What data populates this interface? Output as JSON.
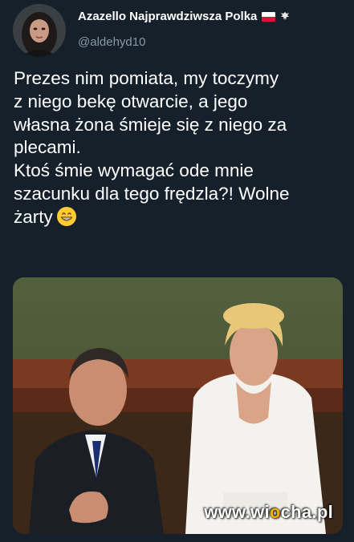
{
  "tweet": {
    "display_name": "Azazello Najprawdziwsza Polka",
    "handle": "@aldehyd10",
    "text": "Prezes nim pomiata, my toczymy\nz niego bekę  otwarcie, a jego\nwłasna żona śmieje się z niego za\nplecami.\nKtoś śmie wymagać ode mnie\nszacunku dla tego frędzla?! Wolne\nżarty",
    "emoji": "grinning-face-emoji",
    "badges": [
      "poland-flag-icon",
      "eagle-icon"
    ]
  },
  "watermark": {
    "prefix": "www.wi",
    "highlight": "o",
    "suffix": "cha.pl"
  },
  "colors": {
    "background": "#15202b",
    "handle": "#8899a6",
    "text": "#ffffff"
  }
}
